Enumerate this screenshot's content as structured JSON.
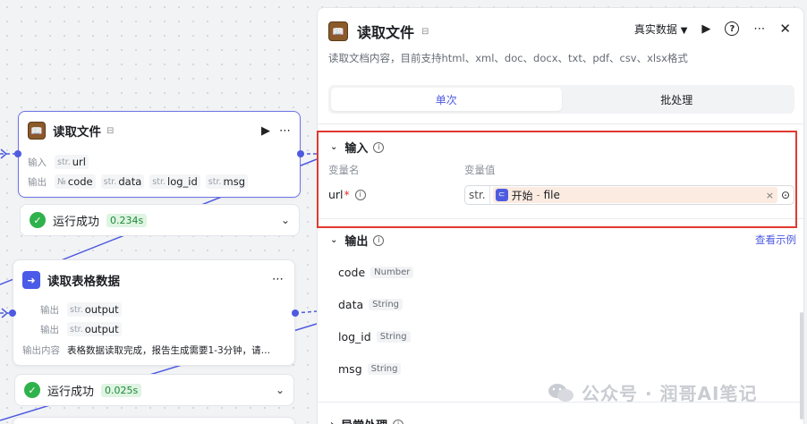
{
  "canvas": {
    "node_read_file": {
      "title": "读取文件",
      "input_label": "输入",
      "inputs": [
        {
          "type": "str.",
          "name": "url"
        }
      ],
      "output_label": "输出",
      "outputs": [
        {
          "type": "№",
          "name": "code"
        },
        {
          "type": "str.",
          "name": "data"
        },
        {
          "type": "str.",
          "name": "log_id"
        },
        {
          "type": "str.",
          "name": "msg"
        }
      ]
    },
    "status_1": {
      "text": "运行成功",
      "time": "0.234s"
    },
    "node_read_table": {
      "title": "读取表格数据",
      "output_label": "输出",
      "outputs": [
        {
          "type": "str.",
          "name": "output"
        },
        {
          "type": "str.",
          "name": "output"
        }
      ],
      "content_label": "输出内容",
      "content": "表格数据读取完成，报告生成需要1-3分钟，请…"
    },
    "status_2": {
      "text": "运行成功",
      "time": "0.025s"
    }
  },
  "panel": {
    "title": "读取文件",
    "data_mode": "真实数据",
    "description": "读取文档内容，目前支持html、xml、doc、docx、txt、pdf、csv、xlsx格式",
    "tabs": [
      {
        "label": "单次",
        "active": true
      },
      {
        "label": "批处理",
        "active": false
      }
    ],
    "input_section": {
      "title": "输入",
      "col_name": "变量名",
      "col_value": "变量值",
      "field": {
        "name": "url",
        "required_mark": "*",
        "type": "str.",
        "ref_node": "开始",
        "ref_sep": "-",
        "ref_var": "file"
      }
    },
    "output_section": {
      "title": "输出",
      "link": "查看示例",
      "items": [
        {
          "name": "code",
          "type": "Number"
        },
        {
          "name": "data",
          "type": "String"
        },
        {
          "name": "log_id",
          "type": "String"
        },
        {
          "name": "msg",
          "type": "String"
        }
      ]
    },
    "error_section": {
      "title": "异常处理"
    }
  },
  "watermark": {
    "text": "公众号 · 润哥AI笔记"
  },
  "colors": {
    "accent": "#4e5be0",
    "success": "#2fb24c",
    "highlight": "#e03a30"
  }
}
